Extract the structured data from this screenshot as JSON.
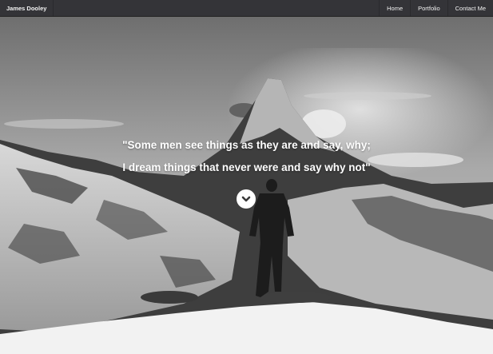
{
  "navbar": {
    "brand": "James Dooley",
    "items": [
      {
        "label": "Home"
      },
      {
        "label": "Portfolio"
      },
      {
        "label": "Contact Me"
      }
    ]
  },
  "hero": {
    "quote_line1": "\"Some men see things as they are and say, why;",
    "quote_line2": "I dream things that never were and say why not\"",
    "scroll_icon": "chevron-down-icon"
  },
  "colors": {
    "navbar_bg": "#343438",
    "nav_text": "#f2f2f2",
    "quote_text": "#ffffff"
  }
}
